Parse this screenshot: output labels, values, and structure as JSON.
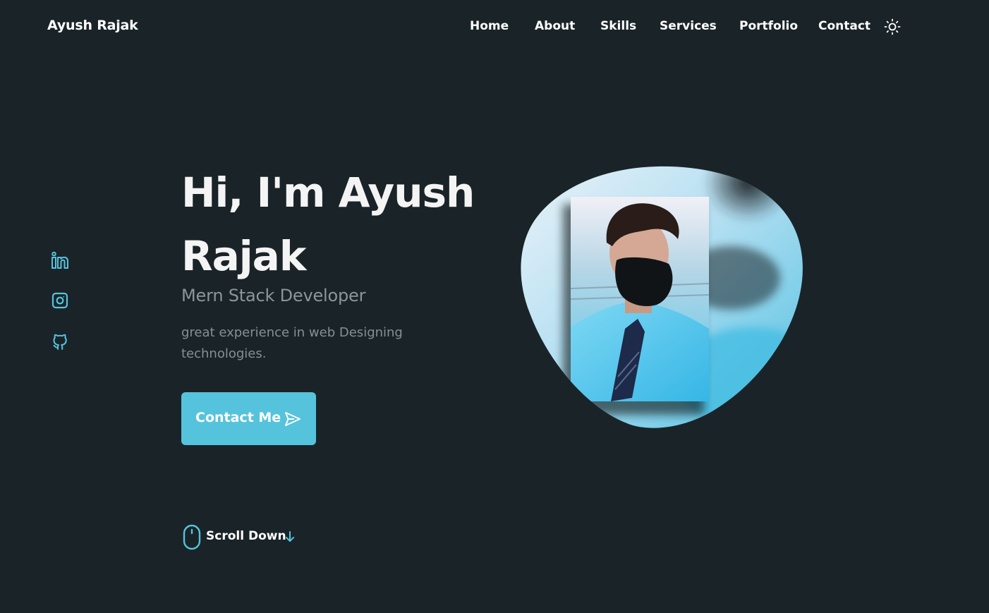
{
  "header": {
    "logo": "Ayush Rajak",
    "nav": [
      "Home",
      "About",
      "Skills",
      "Services",
      "Portfolio",
      "Contact"
    ],
    "theme_icon": "sun-icon"
  },
  "social": [
    {
      "name": "linkedin",
      "icon": "linkedin-icon"
    },
    {
      "name": "instagram",
      "icon": "instagram-icon"
    },
    {
      "name": "github",
      "icon": "github-icon"
    }
  ],
  "hero": {
    "title_line1": "Hi, I'm Ayush",
    "title_line2": "Rajak",
    "subtitle": "Mern Stack Developer",
    "description": "great experience in web Designing technologies.",
    "button_label": "Contact Me",
    "button_icon": "send-icon",
    "profile_image": "profile-photo"
  },
  "scroll": {
    "label": "Scroll Down",
    "mouse_icon": "mouse-icon",
    "arrow_icon": "arrow-down-icon"
  },
  "colors": {
    "background": "#1a2428",
    "accent": "#56c3dd",
    "text": "#ffffff",
    "muted": "#8c9598"
  }
}
